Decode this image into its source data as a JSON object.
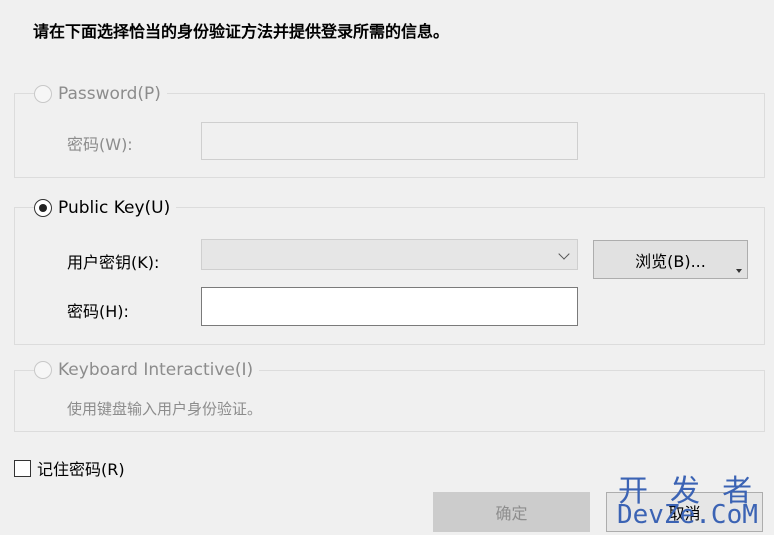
{
  "instruction": "请在下面选择恰当的身份验证方法并提供登录所需的信息。",
  "password_group": {
    "radio_label": "Password(P)",
    "password_label": "密码(W):",
    "password_value": ""
  },
  "publickey_group": {
    "radio_label": "Public Key(U)",
    "user_key_label": "用户密钥(K):",
    "user_key_value": "",
    "browse_label": "浏览(B)...",
    "passphrase_label": "密码(H):",
    "passphrase_value": ""
  },
  "keyboard_group": {
    "radio_label": "Keyboard Interactive(I)",
    "description": "使用键盘输入用户身份验证。"
  },
  "remember": {
    "label": "记住密码(R)"
  },
  "buttons": {
    "ok": "确定",
    "cancel": "取消"
  },
  "watermark": {
    "line1": "开 发 者",
    "line2": "DevZe.CoM"
  }
}
